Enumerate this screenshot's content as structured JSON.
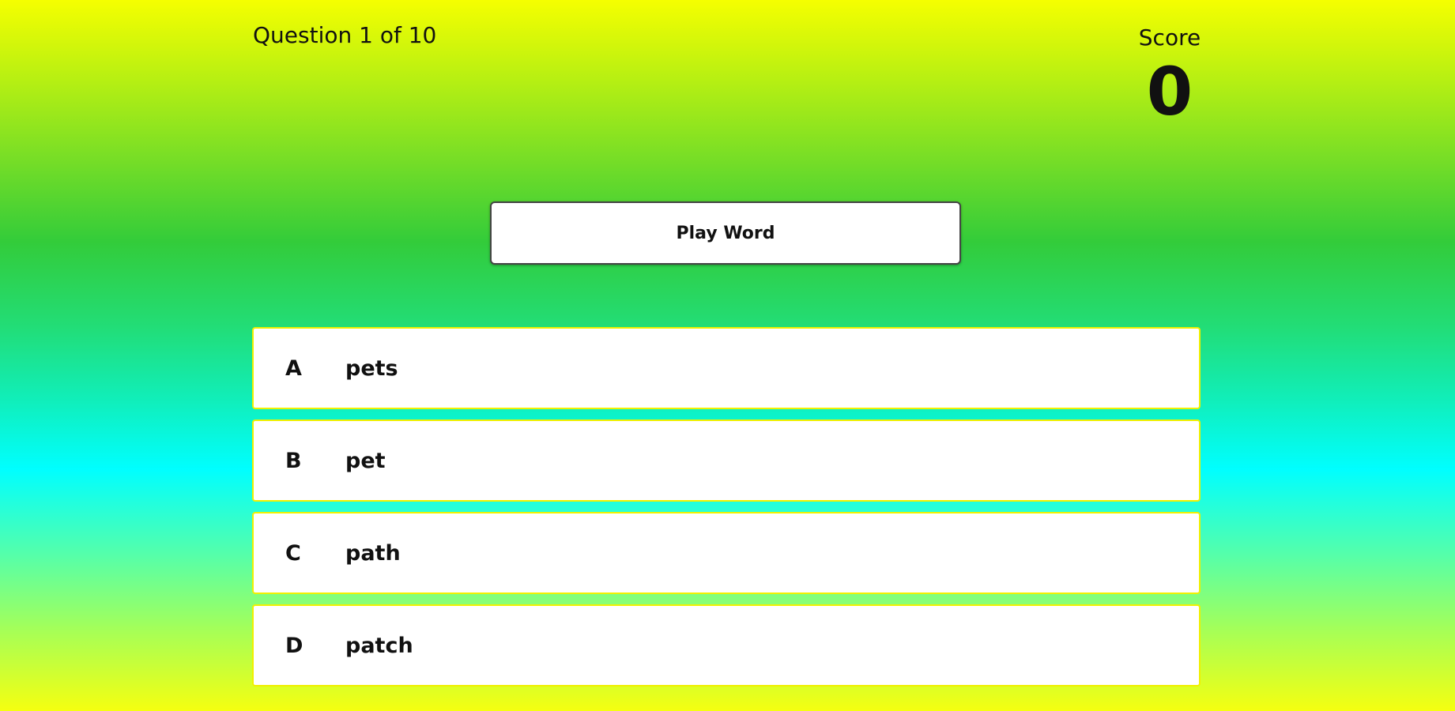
{
  "header": {
    "progress": "Question 1 of 10",
    "score_label": "Score",
    "score_value": "0"
  },
  "play": {
    "label": "Play Word"
  },
  "answers": [
    {
      "letter": "A",
      "word": "pets"
    },
    {
      "letter": "B",
      "word": "pet"
    },
    {
      "letter": "C",
      "word": "path"
    },
    {
      "letter": "D",
      "word": "patch"
    }
  ],
  "colors": {
    "gradient_top": "#f5ff00",
    "gradient_mid_green": "#33cc3a",
    "gradient_cyan": "#00ffff",
    "gradient_bottom": "#f5ff10",
    "answer_border": "#f0f000"
  }
}
